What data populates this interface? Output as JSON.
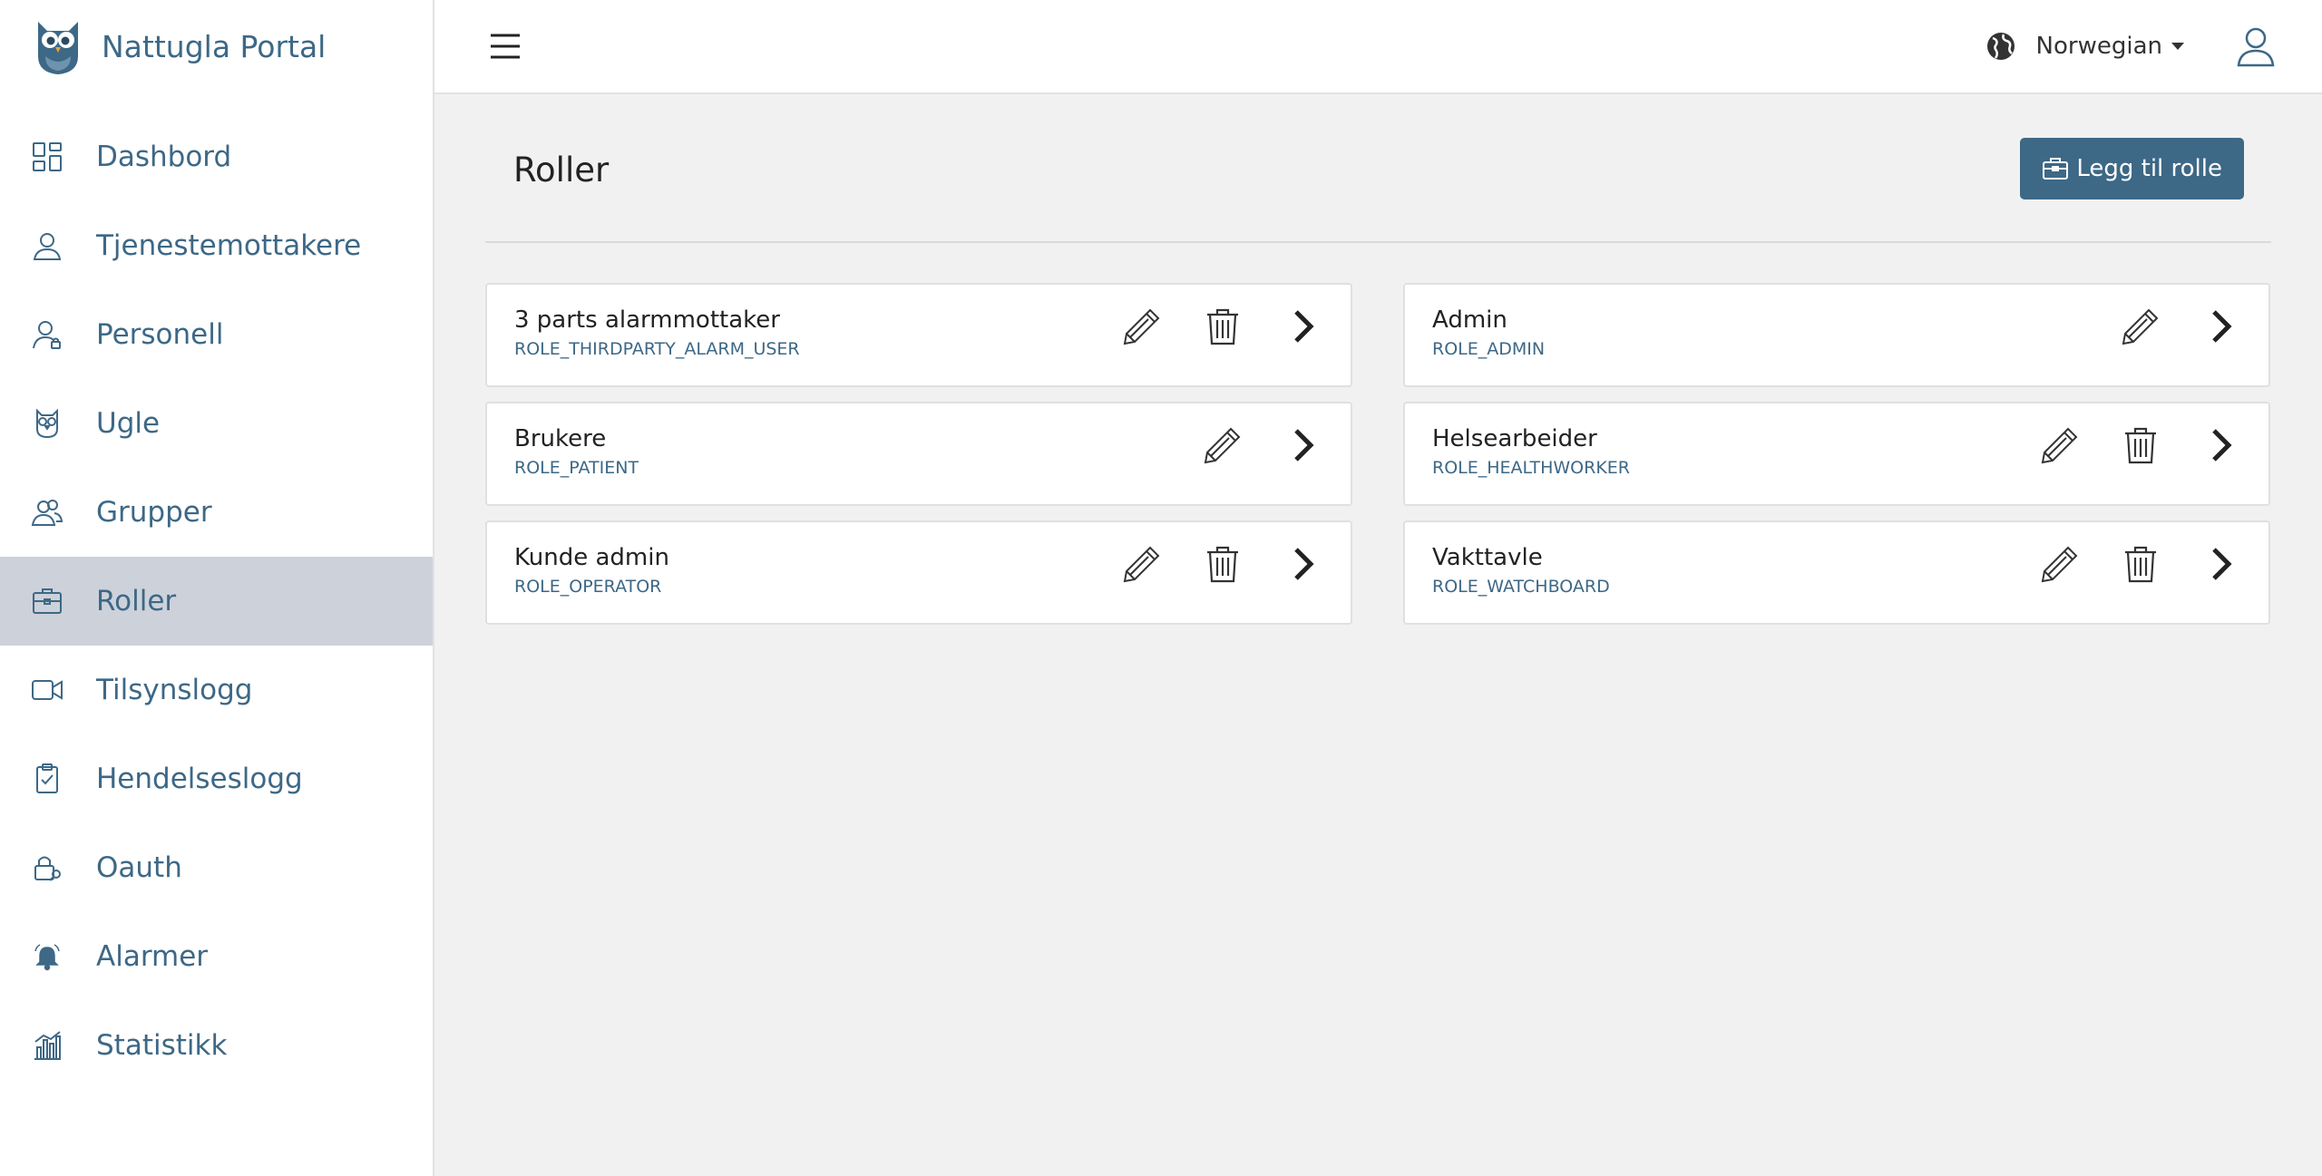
{
  "brand": {
    "name": "Nattugla Portal"
  },
  "sidebar": {
    "items": [
      {
        "label": "Dashbord",
        "icon": "dashboard-icon"
      },
      {
        "label": "Tjenestemottakere",
        "icon": "user-icon"
      },
      {
        "label": "Personell",
        "icon": "personnel-icon"
      },
      {
        "label": "Ugle",
        "icon": "owl-icon"
      },
      {
        "label": "Grupper",
        "icon": "group-icon"
      },
      {
        "label": "Roller",
        "icon": "briefcase-icon",
        "active": true
      },
      {
        "label": "Tilsynslogg",
        "icon": "video-camera-icon"
      },
      {
        "label": "Hendelseslogg",
        "icon": "clipboard-check-icon"
      },
      {
        "label": "Oauth",
        "icon": "lock-key-icon"
      },
      {
        "label": "Alarmer",
        "icon": "alarm-bell-icon"
      },
      {
        "label": "Statistikk",
        "icon": "bar-chart-icon"
      }
    ]
  },
  "topbar": {
    "language": "Norwegian"
  },
  "page": {
    "title": "Roller",
    "add_button": "Legg til rolle"
  },
  "roles": [
    {
      "name": "3 parts alarmmottaker",
      "code": "ROLE_THIRDPARTY_ALARM_USER",
      "deletable": true
    },
    {
      "name": "Admin",
      "code": "ROLE_ADMIN",
      "deletable": false
    },
    {
      "name": "Brukere",
      "code": "ROLE_PATIENT",
      "deletable": false
    },
    {
      "name": "Helsearbeider",
      "code": "ROLE_HEALTHWORKER",
      "deletable": true
    },
    {
      "name": "Kunde admin",
      "code": "ROLE_OPERATOR",
      "deletable": true
    },
    {
      "name": "Vakttavle",
      "code": "ROLE_WATCHBOARD",
      "deletable": true
    }
  ],
  "colors": {
    "brand": "#3d6886",
    "active_nav": "#cdd1da",
    "background": "#f1f1f1"
  }
}
